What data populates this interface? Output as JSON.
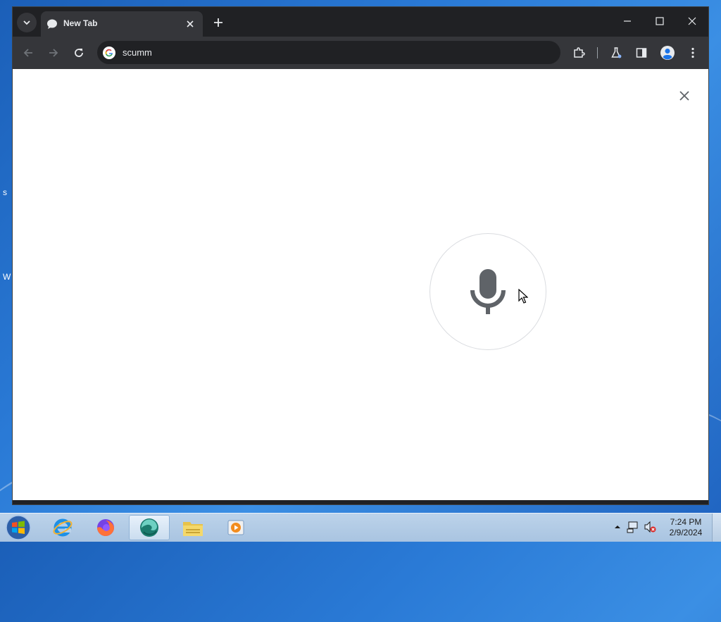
{
  "desktop": {
    "edge_letters": [
      "s",
      "W"
    ]
  },
  "browser": {
    "tab": {
      "title": "New Tab"
    },
    "omnibox": {
      "value": "scumm"
    }
  },
  "voice_search": {
    "mic_icon": "microphone-icon",
    "close_icon": "close-icon"
  },
  "taskbar": {
    "clock_time": "7:24 PM",
    "clock_date": "2/9/2024",
    "items": [
      "internet-explorer-icon",
      "firefox-icon",
      "edge-icon",
      "file-explorer-icon",
      "media-player-icon"
    ]
  },
  "colors": {
    "tabstrip": "#202124",
    "toolbar": "#35363a",
    "text": "#e8eaed",
    "mic": "#5f6368"
  }
}
